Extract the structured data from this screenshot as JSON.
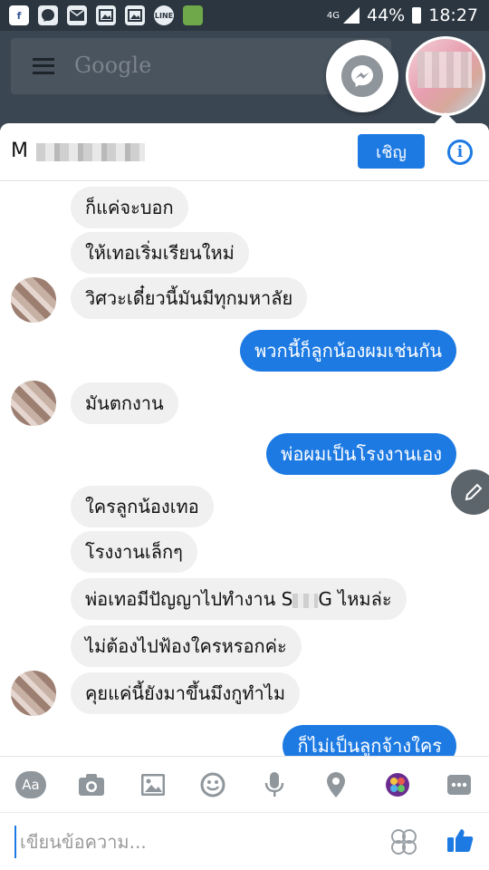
{
  "status_bar": {
    "notification_icons": [
      "facebook-icon",
      "messenger-icon",
      "mail-icon",
      "gallery-icon",
      "gallery-icon",
      "line-icon",
      "game-icon"
    ],
    "network": "4G",
    "battery": "44%",
    "time": "18:27"
  },
  "background_app": {
    "search_logo": "Google"
  },
  "chat_header": {
    "name_initial": "M",
    "invite_label": "เชิญ"
  },
  "messages": [
    {
      "side": "in",
      "text": "ก็แค่จะบอก"
    },
    {
      "side": "in",
      "text": "ให้เทอเริ่มเรียนใหม่"
    },
    {
      "side": "in",
      "text": "วิศวะเดี๋ยวนี้มันมีทุกมหาลัย"
    },
    {
      "side": "out",
      "text": "พวกนี้ก็ลูกน้องผมเช่นกัน"
    },
    {
      "side": "in",
      "text": "มันตกงาน"
    },
    {
      "side": "out",
      "text": "พ่อผมเป็นโรงงานเอง"
    },
    {
      "side": "in",
      "text": "ใครลูกน้องเทอ"
    },
    {
      "side": "in",
      "text": "โรงงานเล็กๆ"
    },
    {
      "side": "in",
      "text_before": "พ่อเทอมีปัญญาไปทำงาน S",
      "text_after": "G ไหมล่ะ"
    },
    {
      "side": "in",
      "text": "ไม่ต้องไปฟ้องใครหรอกค่ะ"
    },
    {
      "side": "in",
      "text": "คุยแค่นี้ยังมาขึ้นมึงกูทำไม"
    },
    {
      "side": "out",
      "text": "ก็ไม่เป็นลูกจ้างใคร"
    }
  ],
  "toolbar": {
    "text_label": "Aa",
    "icons": [
      "camera-icon",
      "image-icon",
      "emoji-icon",
      "microphone-icon",
      "location-icon",
      "games-icon",
      "more-icon"
    ]
  },
  "composer": {
    "placeholder": "เขียนข้อความ...",
    "sticker_icon": "sticker-icon",
    "like_icon": "thumbs-up-icon"
  },
  "colors": {
    "accent": "#1D7AE3",
    "incoming_bubble": "#F1F0F0"
  }
}
